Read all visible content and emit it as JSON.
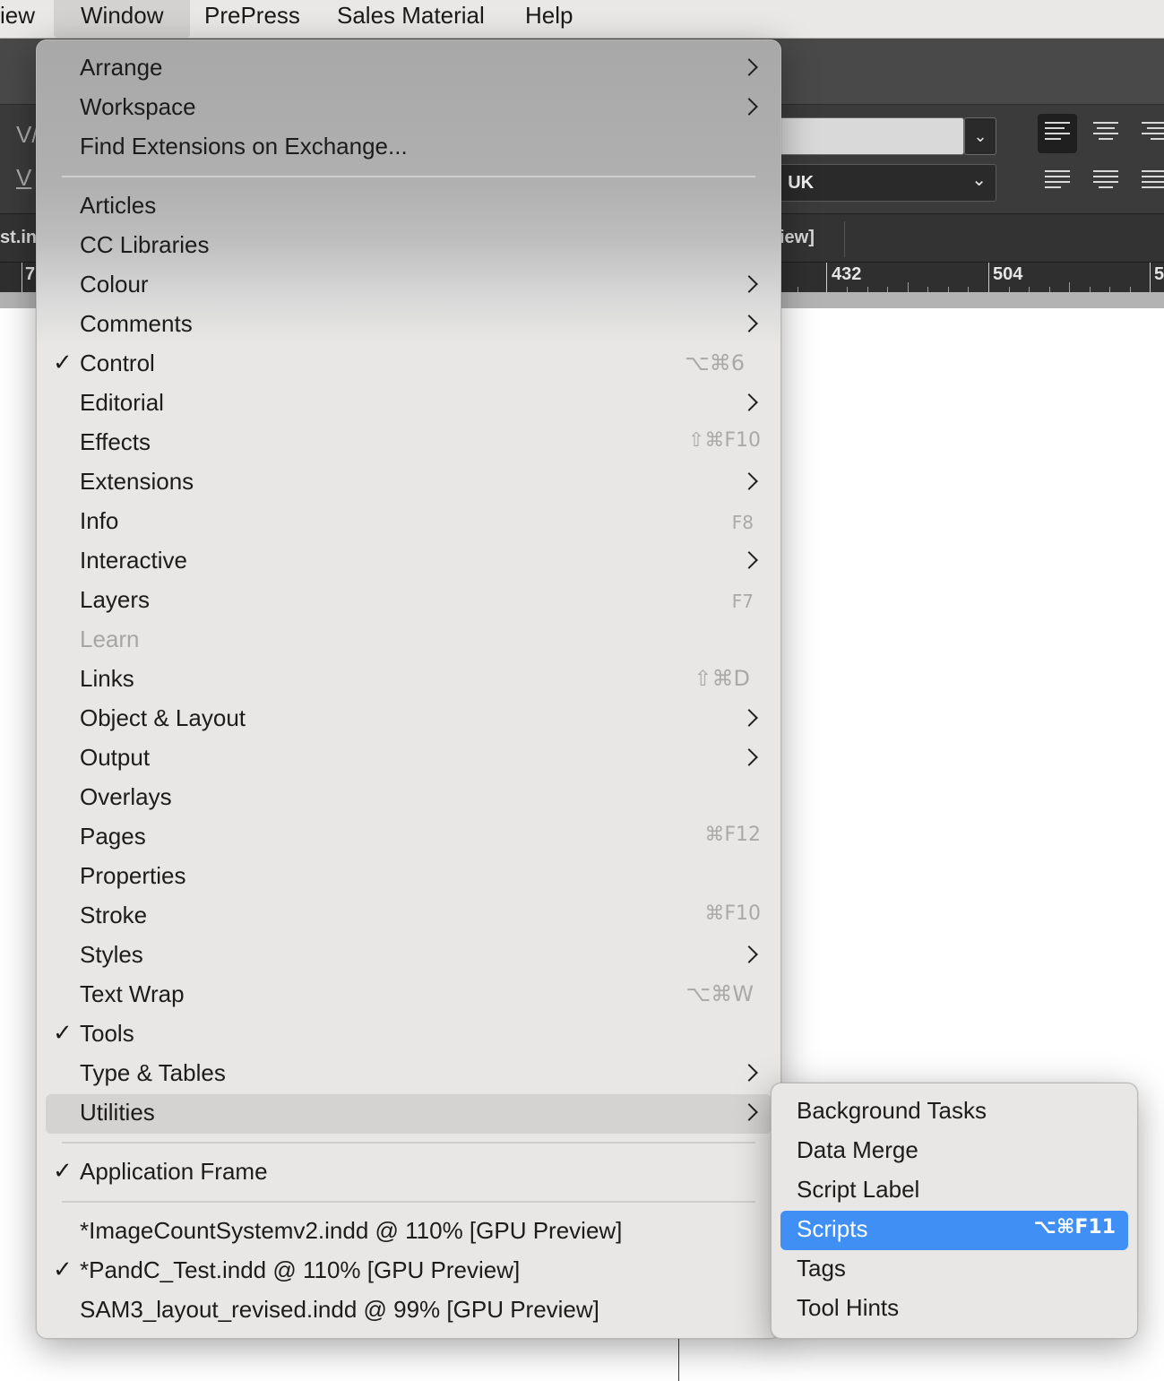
{
  "menubar": {
    "items": [
      "iew",
      "Window",
      "PrePress",
      "Sales Material",
      "Help"
    ],
    "active": "Window"
  },
  "app": {
    "control_glyphs": [
      "V/",
      "V"
    ],
    "language_value": ": UK",
    "tabs": [
      "st.in",
      "iew]"
    ],
    "ruler_labels": [
      "7",
      "432",
      "504",
      "5"
    ]
  },
  "window_menu": {
    "items": [
      {
        "label": "Arrange",
        "submenu": true
      },
      {
        "label": "Workspace",
        "submenu": true
      },
      {
        "label": "Find Extensions on Exchange..."
      },
      {
        "label": "Articles"
      },
      {
        "label": "CC Libraries"
      },
      {
        "label": "Colour",
        "submenu": true
      },
      {
        "label": "Comments",
        "submenu": true
      },
      {
        "label": "Control",
        "checked": true,
        "shortcut": "⌥⌘6"
      },
      {
        "label": "Editorial",
        "submenu": true
      },
      {
        "label": "Effects",
        "shortcut": "⇧⌘F10"
      },
      {
        "label": "Extensions",
        "submenu": true
      },
      {
        "label": "Info",
        "shortcut": "F8"
      },
      {
        "label": "Interactive",
        "submenu": true
      },
      {
        "label": "Layers",
        "shortcut": "F7"
      },
      {
        "label": "Learn",
        "disabled": true
      },
      {
        "label": "Links",
        "shortcut": "⇧⌘D"
      },
      {
        "label": "Object & Layout",
        "submenu": true
      },
      {
        "label": "Output",
        "submenu": true
      },
      {
        "label": "Overlays"
      },
      {
        "label": "Pages",
        "shortcut": "⌘F12"
      },
      {
        "label": "Properties"
      },
      {
        "label": "Stroke",
        "shortcut": "⌘F10"
      },
      {
        "label": "Styles",
        "submenu": true
      },
      {
        "label": "Text Wrap",
        "shortcut": "⌥⌘W"
      },
      {
        "label": "Tools",
        "checked": true
      },
      {
        "label": "Type & Tables",
        "submenu": true
      },
      {
        "label": "Utilities",
        "submenu": true,
        "open": true
      },
      {
        "label": "Application Frame",
        "checked": true
      },
      {
        "label": "*ImageCountSystemv2.indd @ 110% [GPU Preview]"
      },
      {
        "label": "*PandC_Test.indd @ 110% [GPU Preview]",
        "checked": true
      },
      {
        "label": "SAM3_layout_revised.indd @ 99% [GPU Preview]"
      }
    ]
  },
  "utilities_submenu": {
    "items": [
      {
        "label": "Background Tasks"
      },
      {
        "label": "Data Merge"
      },
      {
        "label": "Script Label"
      },
      {
        "label": "Scripts",
        "shortcut": "⌥⌘F11",
        "highlighted": true
      },
      {
        "label": "Tags"
      },
      {
        "label": "Tool Hints"
      }
    ]
  },
  "colors": {
    "highlight": "#3f8ff5",
    "menu_bg": "#e8e7e5",
    "menubar_bg": "#e9e8e6"
  }
}
